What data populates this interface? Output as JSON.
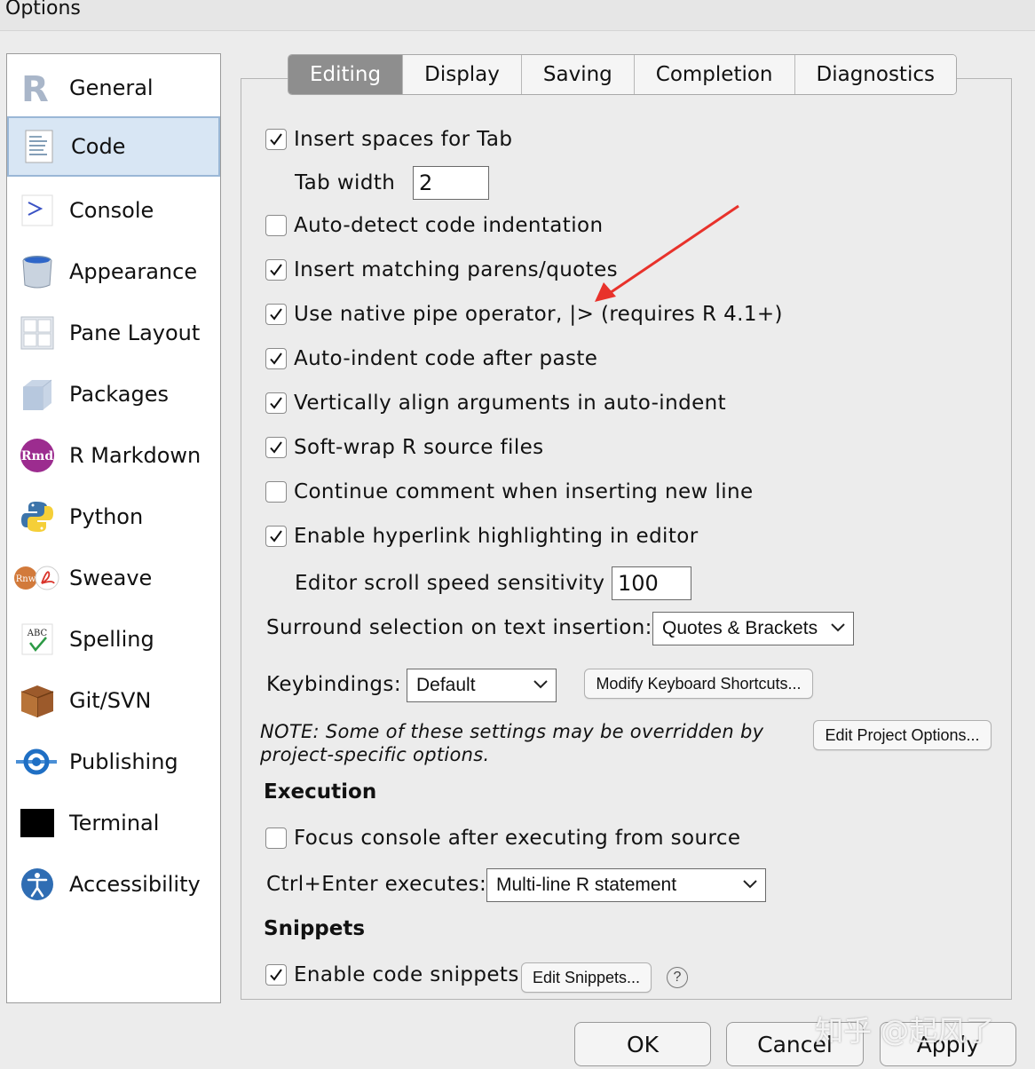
{
  "window": {
    "title": "Options"
  },
  "sidebar": {
    "items": [
      {
        "label": "General"
      },
      {
        "label": "Code",
        "selected": true
      },
      {
        "label": "Console"
      },
      {
        "label": "Appearance"
      },
      {
        "label": "Pane Layout"
      },
      {
        "label": "Packages"
      },
      {
        "label": "R Markdown"
      },
      {
        "label": "Python"
      },
      {
        "label": "Sweave"
      },
      {
        "label": "Spelling"
      },
      {
        "label": "Git/SVN"
      },
      {
        "label": "Publishing"
      },
      {
        "label": "Terminal"
      },
      {
        "label": "Accessibility"
      }
    ]
  },
  "tabs": [
    {
      "label": "Editing",
      "active": true
    },
    {
      "label": "Display"
    },
    {
      "label": "Saving"
    },
    {
      "label": "Completion"
    },
    {
      "label": "Diagnostics"
    }
  ],
  "editing": {
    "insert_spaces": {
      "label": "Insert spaces for Tab",
      "checked": true
    },
    "tab_width": {
      "label": "Tab width",
      "value": "2"
    },
    "auto_detect": {
      "label": "Auto-detect code indentation",
      "checked": false
    },
    "matching_parens": {
      "label": "Insert matching parens/quotes",
      "checked": true
    },
    "native_pipe": {
      "label": "Use native pipe operator, |> (requires R 4.1+)",
      "checked": true
    },
    "auto_indent": {
      "label": "Auto-indent code after paste",
      "checked": true
    },
    "vertical_align": {
      "label": "Vertically align arguments in auto-indent",
      "checked": true
    },
    "soft_wrap": {
      "label": "Soft-wrap R source files",
      "checked": true
    },
    "continue_comment": {
      "label": "Continue comment when inserting new line",
      "checked": false
    },
    "hyperlink": {
      "label": "Enable hyperlink highlighting in editor",
      "checked": true
    },
    "scroll_speed": {
      "label": "Editor scroll speed sensitivity",
      "value": "100"
    },
    "surround": {
      "label": "Surround selection on text insertion:",
      "value": "Quotes & Brackets"
    },
    "keybindings": {
      "label": "Keybindings:",
      "value": "Default"
    },
    "modify_shortcuts": "Modify Keyboard Shortcuts...",
    "note": "NOTE: Some of these settings may be overridden by project-specific options.",
    "note_line1": "NOTE: Some of these settings may be overridden by",
    "note_line2": "project-specific options.",
    "edit_project_options": "Edit Project Options..."
  },
  "execution": {
    "heading": "Execution",
    "focus_console": {
      "label": "Focus console after executing from source",
      "checked": false
    },
    "ctrl_enter": {
      "label": "Ctrl+Enter executes:",
      "value": "Multi-line R statement"
    }
  },
  "snippets": {
    "heading": "Snippets",
    "enable": {
      "label": "Enable code snippets",
      "checked": true
    },
    "edit_button": "Edit Snippets...",
    "help": "?"
  },
  "footer": {
    "ok": "OK",
    "cancel": "Cancel",
    "apply": "Apply"
  },
  "watermark": "知乎 @起风了",
  "colors": {
    "arrow": "#e8322b",
    "selected_bg": "#d8e6f4",
    "active_tab": "#8e8e8e"
  }
}
